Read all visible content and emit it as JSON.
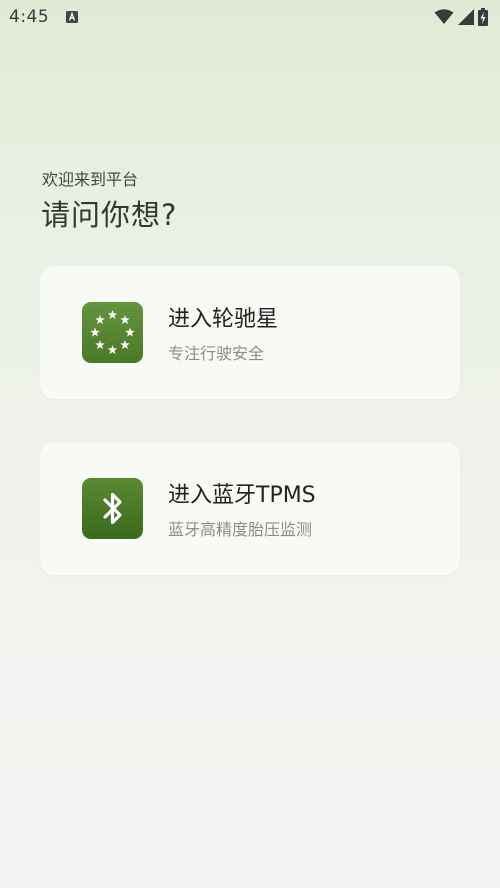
{
  "status_bar": {
    "time": "4:45",
    "notification_icon": "font-a-icon",
    "icons": [
      "wifi-icon",
      "signal-icon",
      "battery-charging-icon"
    ]
  },
  "header": {
    "welcome": "欢迎来到平台",
    "question": "请问你想?"
  },
  "cards": [
    {
      "title": "进入轮驰星",
      "subtitle": "专注行驶安全",
      "icon": "stars-circle-icon",
      "icon_color": "#5a8a35"
    },
    {
      "title": "进入蓝牙TPMS",
      "subtitle": "蓝牙高精度胎压监测",
      "icon": "bluetooth-icon",
      "icon_color": "#4a7a28"
    }
  ]
}
